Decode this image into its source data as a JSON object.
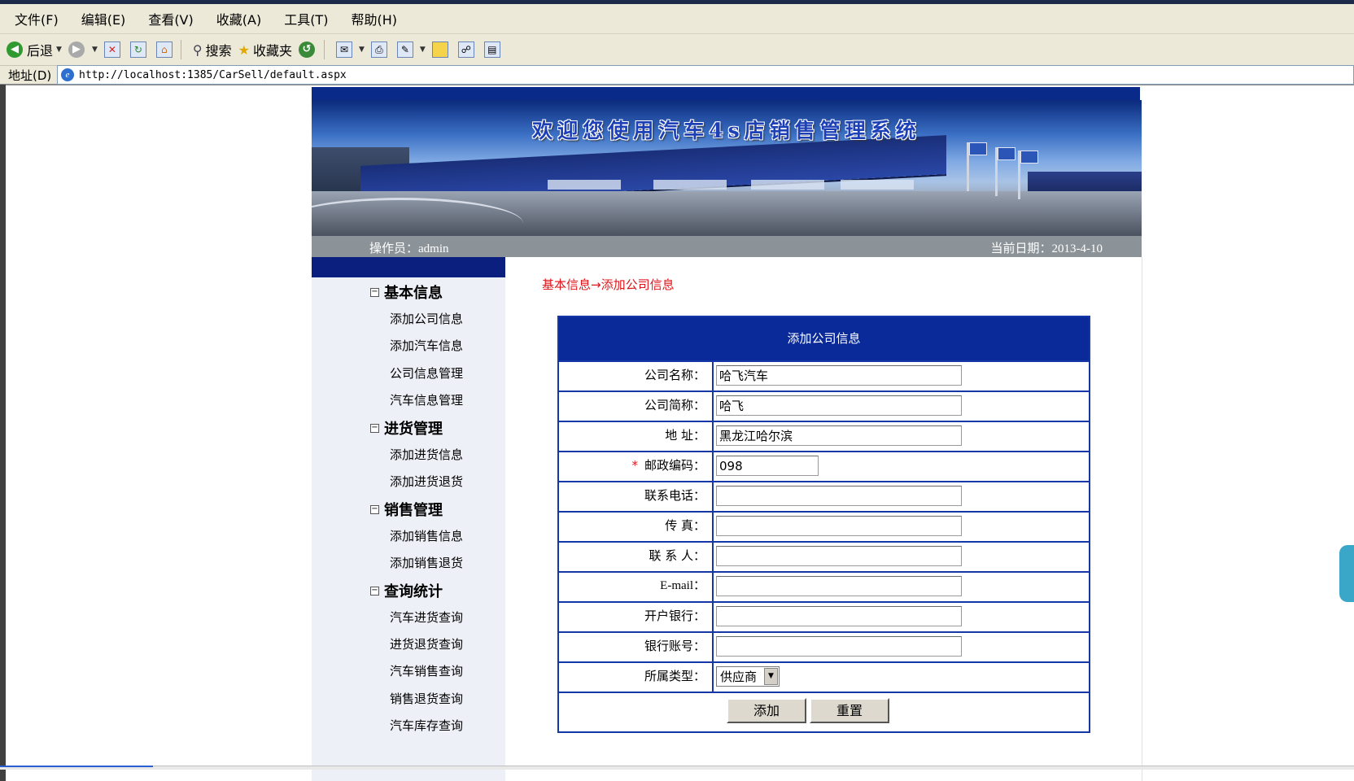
{
  "browser": {
    "menu": [
      "文件(F)",
      "编辑(E)",
      "查看(V)",
      "收藏(A)",
      "工具(T)",
      "帮助(H)"
    ],
    "toolbar": {
      "back": "后退",
      "search": "搜索",
      "favorites": "收藏夹"
    },
    "address_label": "地址(D)",
    "url": "http://localhost:1385/CarSell/default.aspx"
  },
  "header": {
    "banner_title": "欢迎您使用汽车4s店销售管理系统",
    "operator": "操作员：admin",
    "date": "当前日期：2013-4-10"
  },
  "sidebar": {
    "groups": [
      {
        "title": "基本信息",
        "items": [
          "添加公司信息",
          "添加汽车信息",
          "公司信息管理",
          "汽车信息管理"
        ]
      },
      {
        "title": "进货管理",
        "items": [
          "添加进货信息",
          "添加进货退货"
        ]
      },
      {
        "title": "销售管理",
        "items": [
          "添加销售信息",
          "添加销售退货"
        ]
      },
      {
        "title": "查询统计",
        "items": [
          "汽车进货查询",
          "进货退货查询",
          "汽车销售查询",
          "销售退货查询",
          "汽车库存查询"
        ]
      }
    ]
  },
  "main": {
    "breadcrumb": "基本信息→添加公司信息",
    "form_title": "添加公司信息",
    "fields": [
      {
        "label": "公司名称：",
        "value": "哈飞汽车"
      },
      {
        "label": "公司简称：",
        "value": "哈飞"
      },
      {
        "label": "地 址：",
        "value": "黑龙江哈尔滨"
      },
      {
        "label": "邮政编码：",
        "value": "098",
        "required": "*"
      },
      {
        "label": "联系电话：",
        "value": ""
      },
      {
        "label": "传 真：",
        "value": ""
      },
      {
        "label": "联 系 人：",
        "value": ""
      },
      {
        "label": "E-mail：",
        "value": ""
      },
      {
        "label": "开户银行：",
        "value": ""
      },
      {
        "label": "银行账号：",
        "value": ""
      }
    ],
    "type_label": "所属类型：",
    "type_selected": "供应商",
    "add_button": "添加",
    "reset_button": "重置"
  },
  "colors": {
    "nav_blue": "#0a2a9a",
    "crumb_red": "#e0141b",
    "info_gray": "#8c9398"
  }
}
